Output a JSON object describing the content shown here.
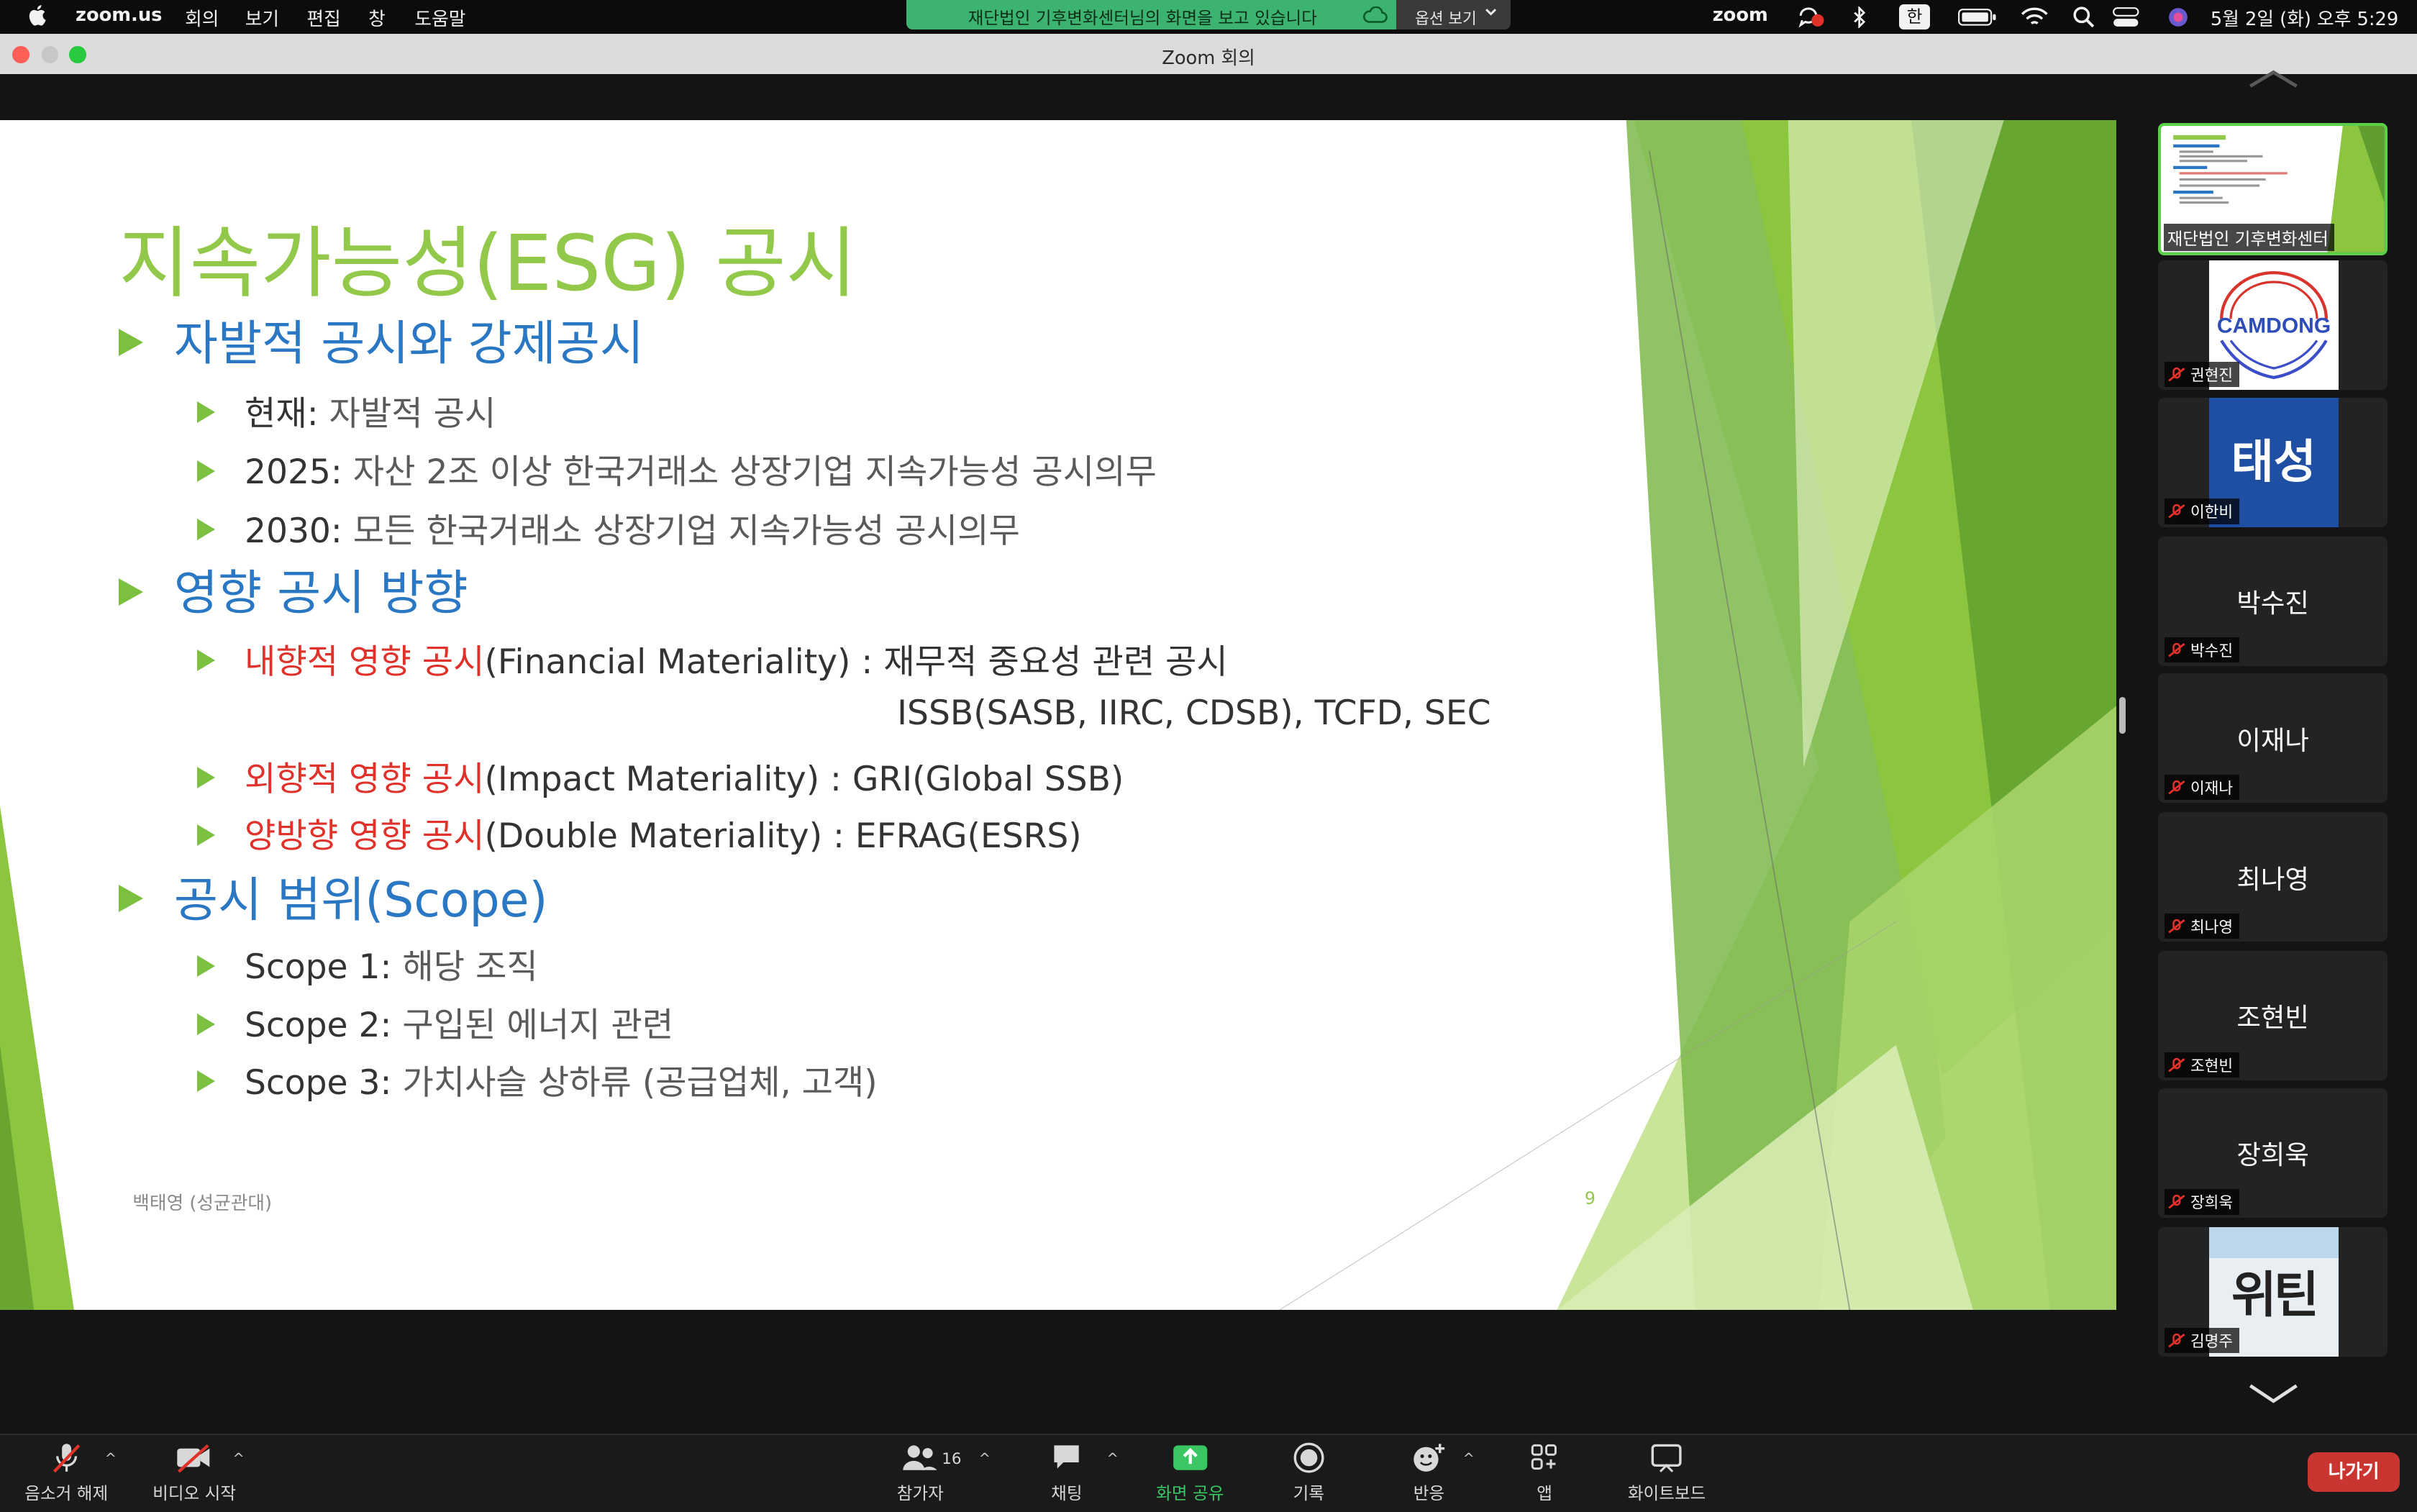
{
  "menubar": {
    "app": "zoom.us",
    "items": [
      "회의",
      "보기",
      "편집",
      "창",
      "도움말"
    ],
    "share_banner": "재단법인 기후변화센터님의 화면을 보고 있습니다",
    "view_options": "옵션 보기",
    "status_app": "zoom",
    "input_method": "한",
    "datetime": "5월 2일 (화) 오후 5:29"
  },
  "window": {
    "title": "Zoom 회의"
  },
  "slide": {
    "title": "지속가능성(ESG) 공시",
    "sections": [
      {
        "heading": "자발적 공시와 강제공시",
        "items": [
          {
            "lead": "현재:",
            "text": " 자발적 공시"
          },
          {
            "lead": "2025:",
            "text": " 자산 2조 이상 한국거래소 상장기업 지속가능성 공시의무"
          },
          {
            "lead": "2030:",
            "text": " 모든 한국거래소 상장기업 지속가능성 공시의무"
          }
        ]
      },
      {
        "heading": "영향 공시 방향",
        "items": [
          {
            "red": "내향적 영향 공시",
            "text": "(Financial Materiality) :  재무적 중요성 관련 공시",
            "cont": "ISSB(SASB, IIRC, CDSB), TCFD, SEC"
          },
          {
            "red": "외향적 영향 공시",
            "text": "(Impact Materiality) : GRI(Global SSB)"
          },
          {
            "red": "양방향 영향 공시",
            "text": "(Double Materiality) : EFRAG(ESRS)"
          }
        ]
      },
      {
        "heading": "공시 범위(Scope)",
        "items": [
          {
            "lead": "Scope 1:",
            "text": " 해당 조직"
          },
          {
            "lead": "Scope 2:",
            "text": " 구입된 에너지 관련"
          },
          {
            "lead": "Scope 3:",
            "text": " 가치사슬 상하류 (공급업체, 고객)"
          }
        ]
      }
    ],
    "footer": "백태영 (성균관대)",
    "page_number": "9",
    "accent_green": "#92c94a",
    "heading_blue": "#2a78c4",
    "emphasis_red": "#e0322a"
  },
  "participants": [
    {
      "name": "재단법인 기후변화센터",
      "kind": "screen-share"
    },
    {
      "name": "권현진",
      "kind": "image",
      "image_text": "CAMDONG"
    },
    {
      "name": "이한비",
      "kind": "image",
      "image_text": "태성"
    },
    {
      "name": "박수진",
      "kind": "text"
    },
    {
      "name": "이재나",
      "kind": "text"
    },
    {
      "name": "최나영",
      "kind": "text"
    },
    {
      "name": "조현빈",
      "kind": "text"
    },
    {
      "name": "장희욱",
      "kind": "text"
    },
    {
      "name": "김명주",
      "kind": "image",
      "image_text": "위틴"
    }
  ],
  "toolbar": {
    "unmute": "음소거 해제",
    "start_video": "비디오 시작",
    "participants": "참가자",
    "participant_count": "16",
    "chat": "채팅",
    "share_screen": "화면 공유",
    "record": "기록",
    "reactions": "반응",
    "apps": "앱",
    "whiteboard": "화이트보드",
    "leave": "나가기"
  }
}
